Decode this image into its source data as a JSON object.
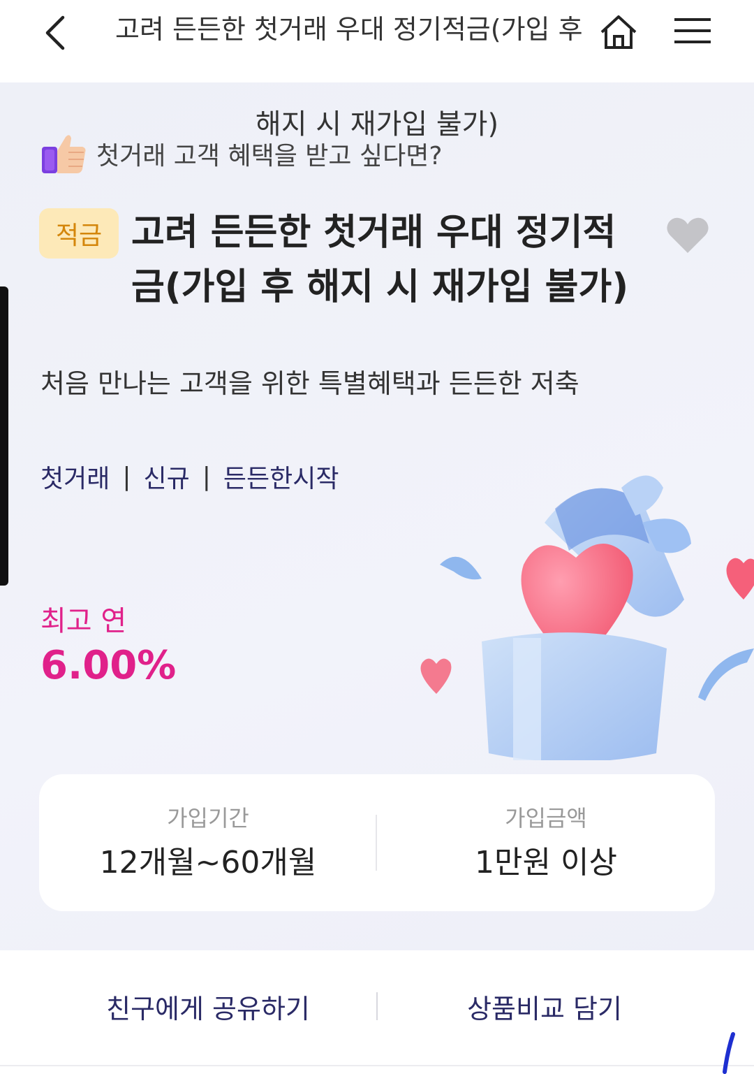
{
  "header": {
    "title_line1": "고려 든든한 첫거래 우대 정기적금(가입 후",
    "title_line2": "해지 시 재가입 불가)"
  },
  "promo": {
    "text": "첫거래 고객 혜택을 받고 싶다면?",
    "icon": "thumbs-up-icon"
  },
  "product": {
    "badge": "적금",
    "title": "고려 든든한 첫거래 우대 정기적금(가입 후 해지 시 재가입 불가)",
    "description": "처음 만나는 고객을 위한 특별혜택과 든든한 저축",
    "tags": [
      "첫거래",
      "신규",
      "든든한시작"
    ],
    "tag_separator": "|",
    "rate_label": "최고 연",
    "rate_value": "6.00%"
  },
  "info": {
    "period_label": "가입기간",
    "period_value": "12개월~60개월",
    "amount_label": "가입금액",
    "amount_value": "1만원 이상"
  },
  "actions": {
    "share": "친구에게 공유하기",
    "compare": "상품비교 담기"
  },
  "colors": {
    "accent_pink": "#e0218a",
    "badge_bg": "#fde9b8",
    "badge_text": "#d4860b",
    "tag_text": "#2a2a66"
  }
}
